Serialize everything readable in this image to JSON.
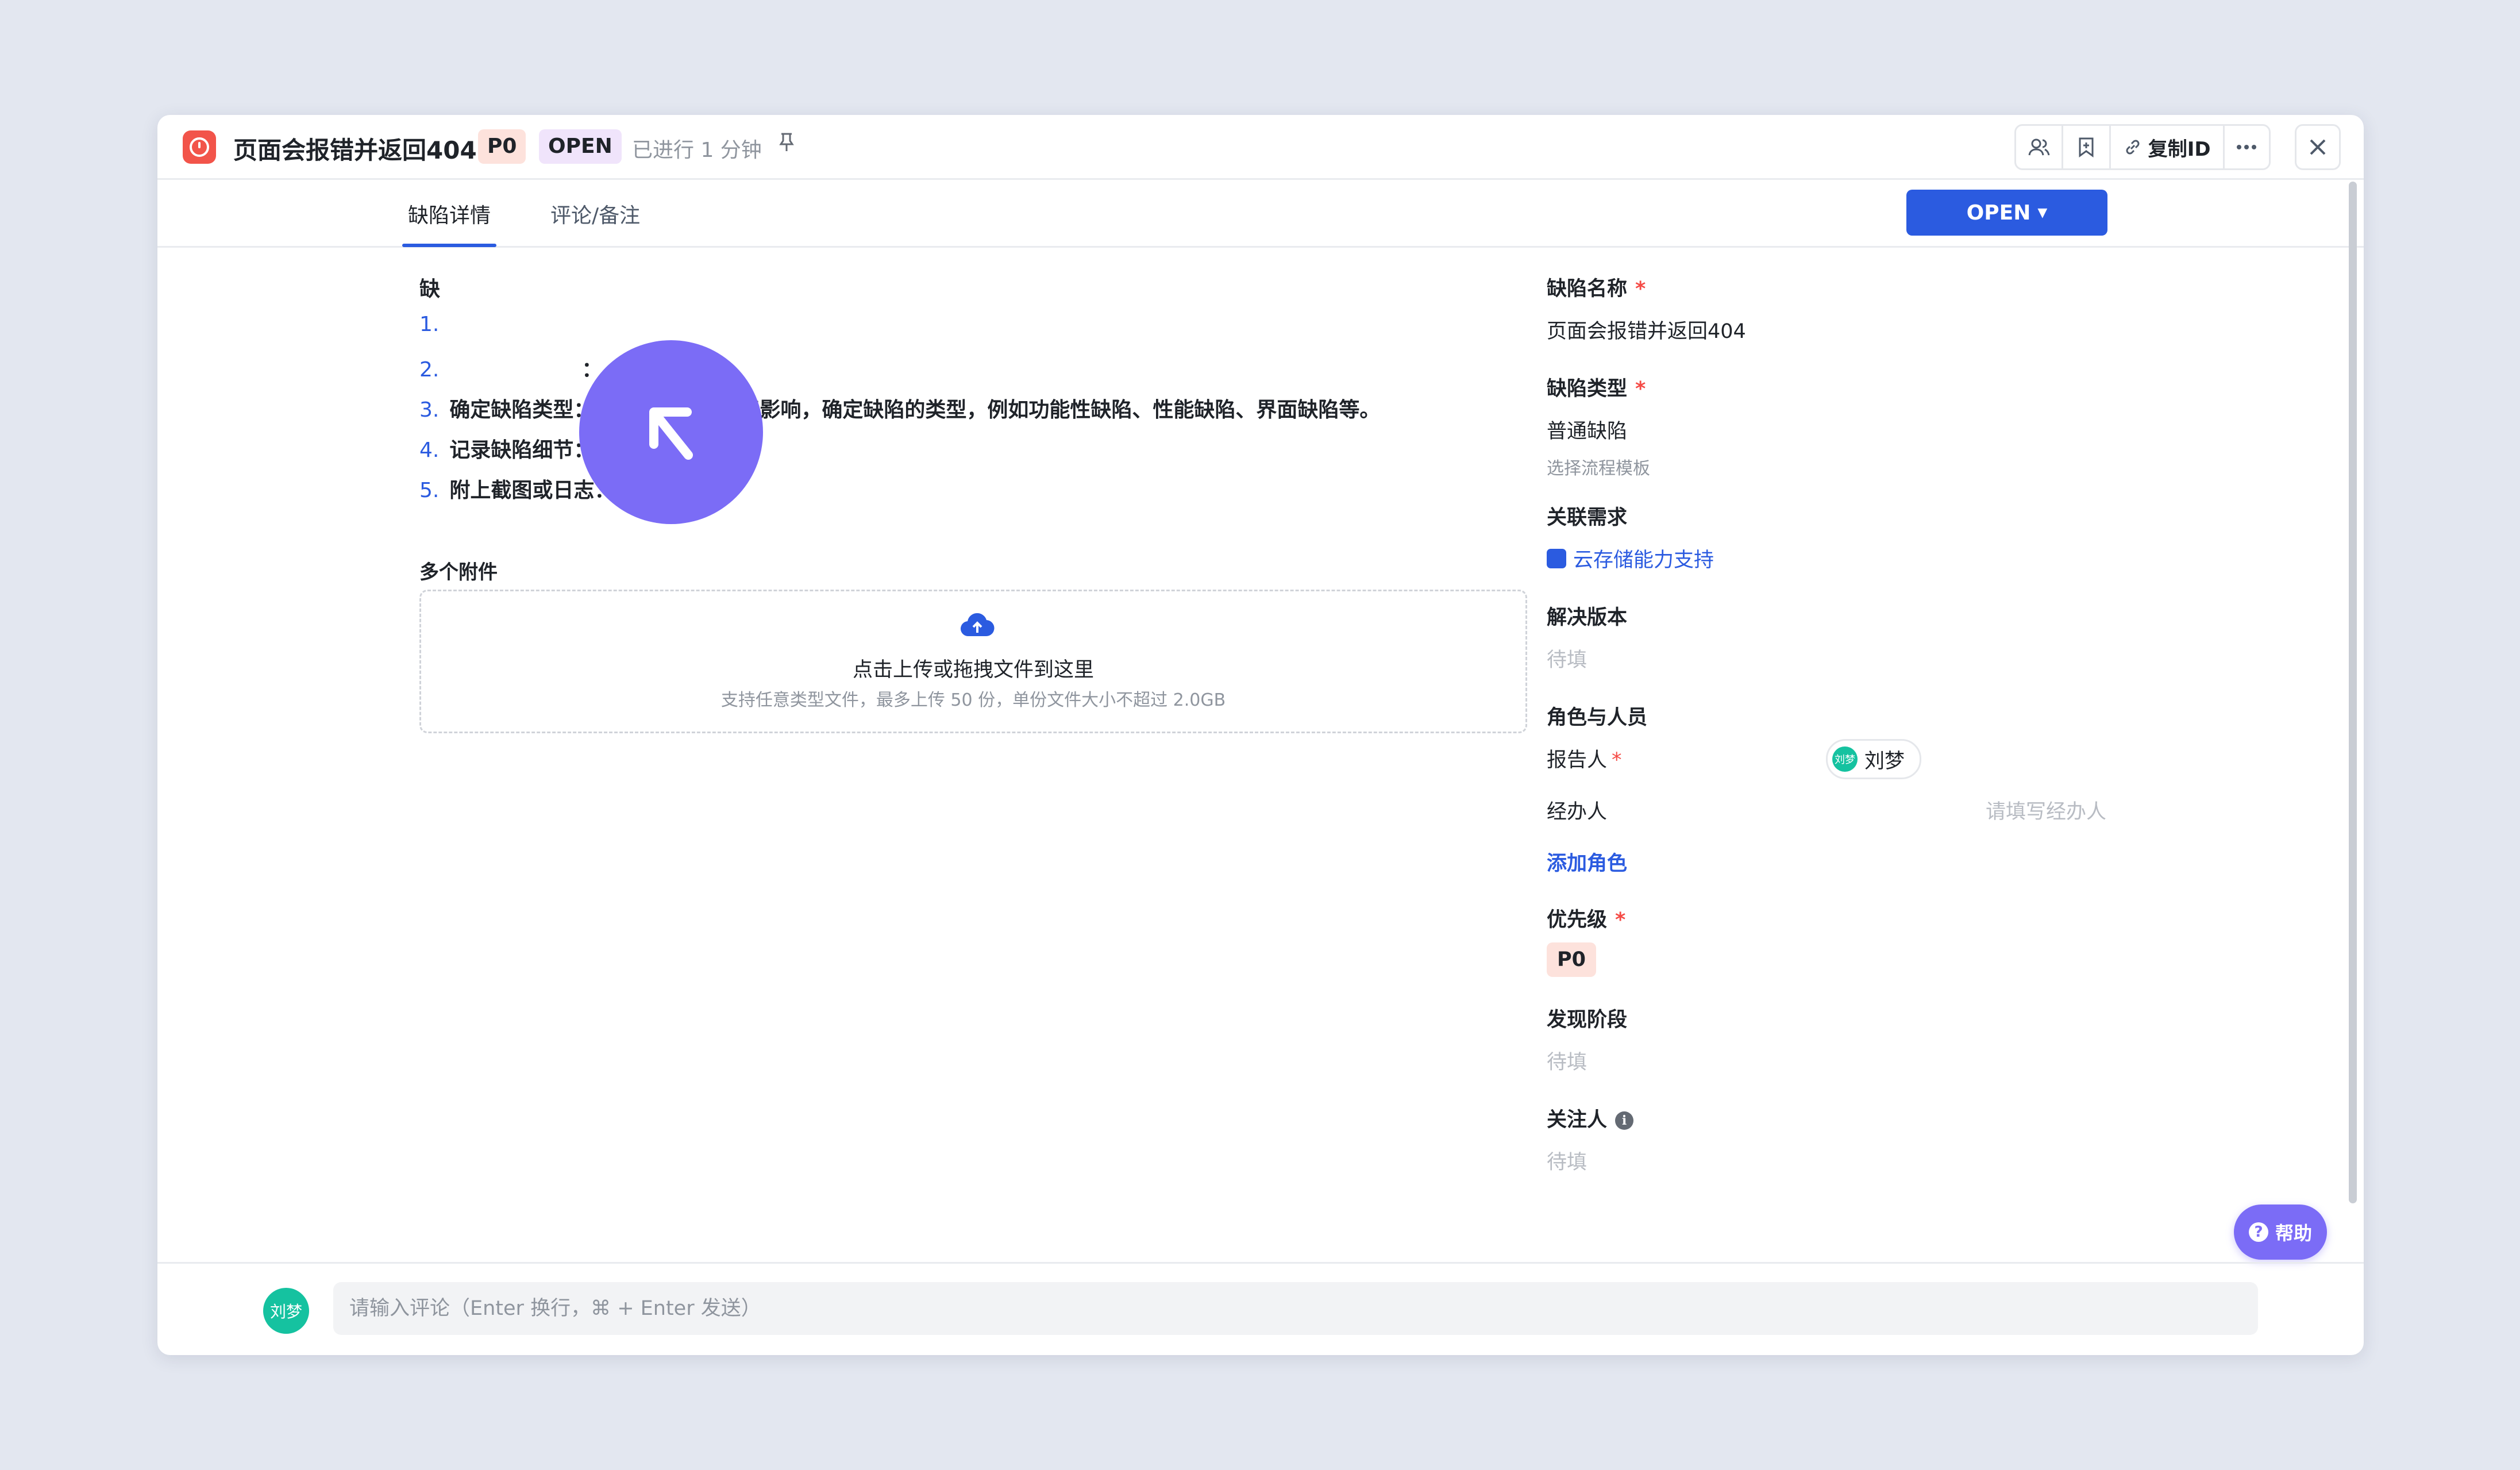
{
  "header": {
    "title": "页面会报错并返回404",
    "priority_tag": "P0",
    "status_tag": "OPEN",
    "elapsed": "已进行 1 分钟",
    "copy_id_label": "复制ID"
  },
  "tabs": [
    {
      "label": "缺陷详情",
      "active": true
    },
    {
      "label": "评论/备注",
      "active": false
    }
  ],
  "status_button": {
    "label": "OPEN"
  },
  "description": {
    "label": "缺",
    "items": [
      {
        "num": "1.",
        "text": ""
      },
      {
        "num": "2.",
        "text": "："
      },
      {
        "num": "3.",
        "text": "确定缺陷类型：根据缺陷的现象和影响，确定缺陷的类型，例如功能性缺陷、性能缺陷、界面缺陷等。"
      },
      {
        "num": "4.",
        "text": "记录缺陷细节："
      },
      {
        "num": "5.",
        "text": "附上截图或日志："
      }
    ]
  },
  "attachments": {
    "label": "多个附件",
    "upload_main": "点击上传或拖拽文件到这里",
    "upload_sub": "支持任意类型文件，最多上传 50 份，单份文件大小不超过 2.0GB"
  },
  "fields": {
    "name": {
      "label": "缺陷名称",
      "value": "页面会报错并返回404"
    },
    "type": {
      "label": "缺陷类型",
      "value": "普通缺陷",
      "note": "选择流程模板"
    },
    "requirement": {
      "label": "关联需求",
      "value": "云存储能力支持"
    },
    "version": {
      "label": "解决版本",
      "value": "待填"
    },
    "roles": {
      "label": "角色与人员",
      "reporter_label": "报告人",
      "reporter_name": "刘梦",
      "reporter_avatar": "刘梦",
      "handler_label": "经办人",
      "handler_placeholder": "请填写经办人",
      "add_role": "添加角色"
    },
    "priority": {
      "label": "优先级",
      "value": "P0"
    },
    "stage": {
      "label": "发现阶段",
      "value": "待填"
    },
    "followers": {
      "label": "关注人",
      "value": "待填"
    }
  },
  "help": {
    "label": "帮助"
  },
  "comment": {
    "avatar": "刘梦",
    "placeholder": "请输入评论（Enter 换行，⌘ + Enter 发送）"
  },
  "colors": {
    "accent": "#2b5be0",
    "danger": "#f2544a",
    "help": "#7b6cf6",
    "avatar": "#15c2a0"
  }
}
